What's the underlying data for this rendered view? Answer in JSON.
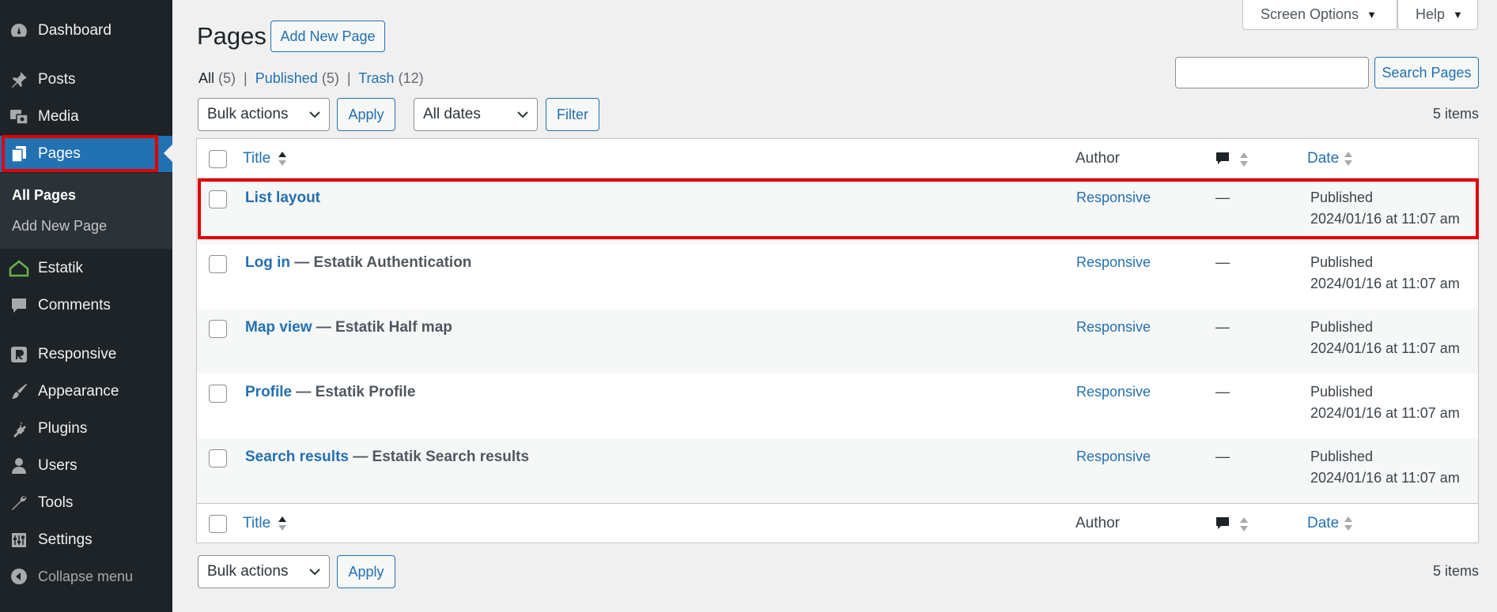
{
  "sidebar": {
    "items": [
      {
        "label": "Dashboard",
        "icon": "dashboard-icon"
      },
      {
        "label": "Posts",
        "icon": "pin-icon"
      },
      {
        "label": "Media",
        "icon": "media-icon"
      },
      {
        "label": "Pages",
        "icon": "pages-icon"
      },
      {
        "label": "Estatik",
        "icon": "house-icon"
      },
      {
        "label": "Comments",
        "icon": "comment-icon"
      },
      {
        "label": "Responsive",
        "icon": "responsive-logo-icon"
      },
      {
        "label": "Appearance",
        "icon": "brush-icon"
      },
      {
        "label": "Plugins",
        "icon": "plug-icon"
      },
      {
        "label": "Users",
        "icon": "user-icon"
      },
      {
        "label": "Tools",
        "icon": "wrench-icon"
      },
      {
        "label": "Settings",
        "icon": "sliders-icon"
      }
    ],
    "submenu": [
      "All Pages",
      "Add New Page"
    ],
    "collapse_label": "Collapse menu"
  },
  "top_tabs": {
    "screen_options": "Screen Options",
    "help": "Help"
  },
  "header": {
    "title": "Pages",
    "add_new": "Add New Page"
  },
  "views": {
    "all": "All",
    "all_count": "(5)",
    "published": "Published",
    "published_count": "(5)",
    "trash": "Trash",
    "trash_count": "(12)",
    "sep": "|"
  },
  "search": {
    "button": "Search Pages",
    "value": ""
  },
  "toolbar": {
    "bulk_actions": "Bulk actions",
    "apply": "Apply",
    "dates": "All dates",
    "filter": "Filter",
    "items_count": "5 items"
  },
  "table": {
    "columns": {
      "title": "Title",
      "author": "Author",
      "date": "Date"
    },
    "rows": [
      {
        "title": "List layout",
        "state": "",
        "author": "Responsive",
        "comments": "—",
        "status": "Published",
        "date": "2024/01/16 at 11:07 am"
      },
      {
        "title": "Log in",
        "state": " — Estatik Authentication",
        "author": "Responsive",
        "comments": "—",
        "status": "Published",
        "date": "2024/01/16 at 11:07 am"
      },
      {
        "title": "Map view",
        "state": " — Estatik Half map",
        "author": "Responsive",
        "comments": "—",
        "status": "Published",
        "date": "2024/01/16 at 11:07 am"
      },
      {
        "title": "Profile",
        "state": " — Estatik Profile",
        "author": "Responsive",
        "comments": "—",
        "status": "Published",
        "date": "2024/01/16 at 11:07 am"
      },
      {
        "title": "Search results",
        "state": " — Estatik Search results",
        "author": "Responsive",
        "comments": "—",
        "status": "Published",
        "date": "2024/01/16 at 11:07 am"
      }
    ]
  }
}
